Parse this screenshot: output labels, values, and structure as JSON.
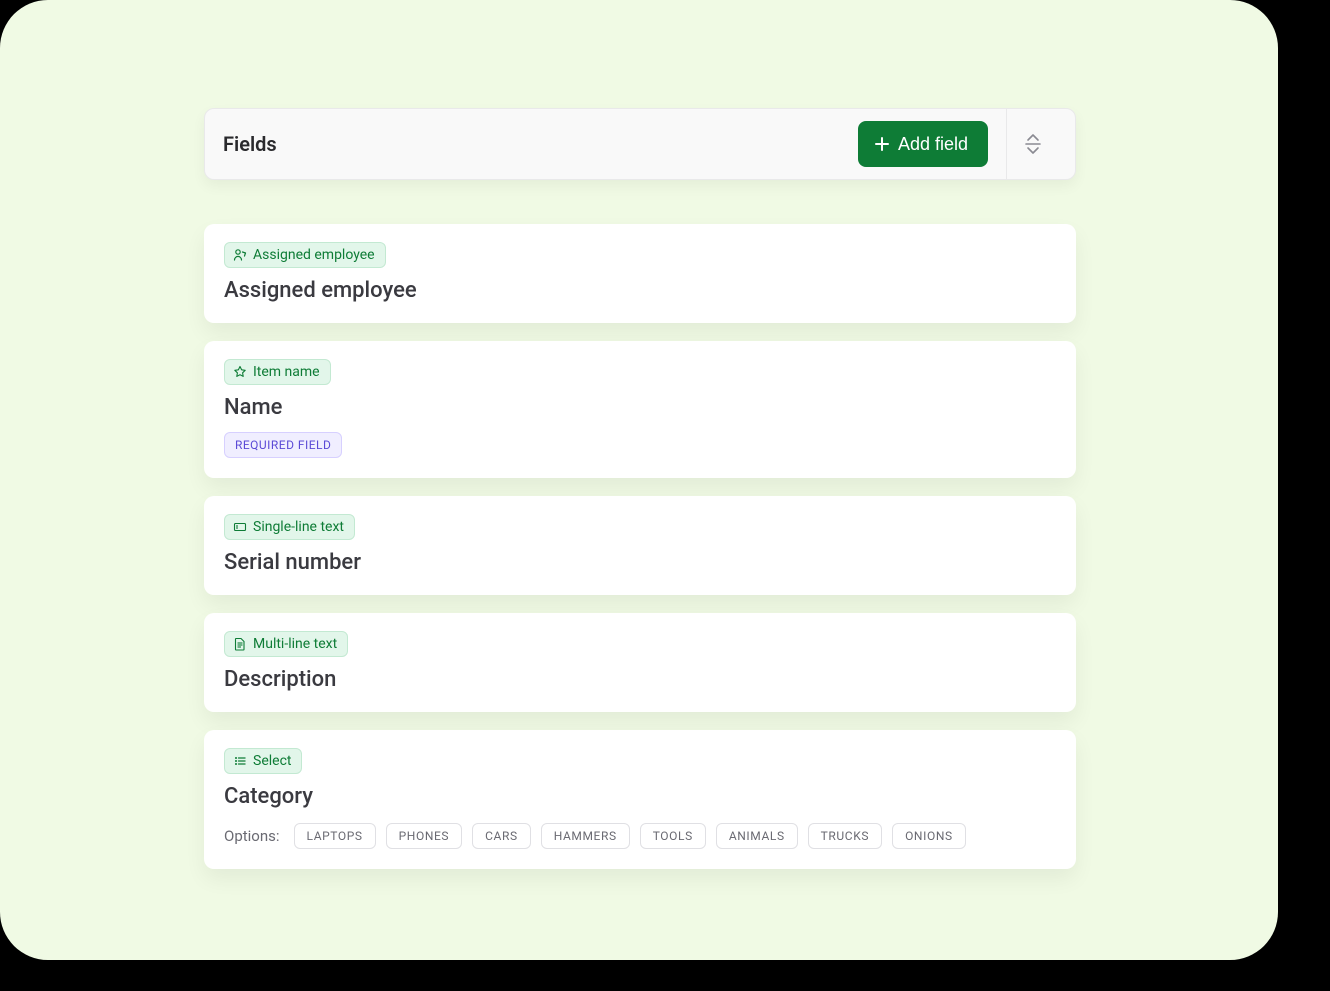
{
  "header": {
    "title": "Fields",
    "add_button_label": "Add field"
  },
  "required_label": "REQUIRED FIELD",
  "options_label": "Options:",
  "fields": [
    {
      "type_label": "Assigned employee",
      "name": "Assigned employee",
      "icon": "user",
      "required": false,
      "options": null
    },
    {
      "type_label": "Item name",
      "name": "Name",
      "icon": "star",
      "required": true,
      "options": null
    },
    {
      "type_label": "Single-line text",
      "name": "Serial number",
      "icon": "text-line",
      "required": false,
      "options": null
    },
    {
      "type_label": "Multi-line text",
      "name": "Description",
      "icon": "doc",
      "required": false,
      "options": null
    },
    {
      "type_label": "Select",
      "name": "Category",
      "icon": "list",
      "required": false,
      "options": [
        "LAPTOPS",
        "PHONES",
        "CARS",
        "HAMMERS",
        "TOOLS",
        "ANIMALS",
        "TRUCKS",
        "ONIONS"
      ]
    }
  ],
  "colors": {
    "accent": "#0e7c36",
    "pill_bg": "#e2f6ea",
    "pill_border": "#c3e9d2",
    "required_bg": "#f0eeff",
    "required_border": "#d7d0ff",
    "required_text": "#5b4ad6"
  }
}
